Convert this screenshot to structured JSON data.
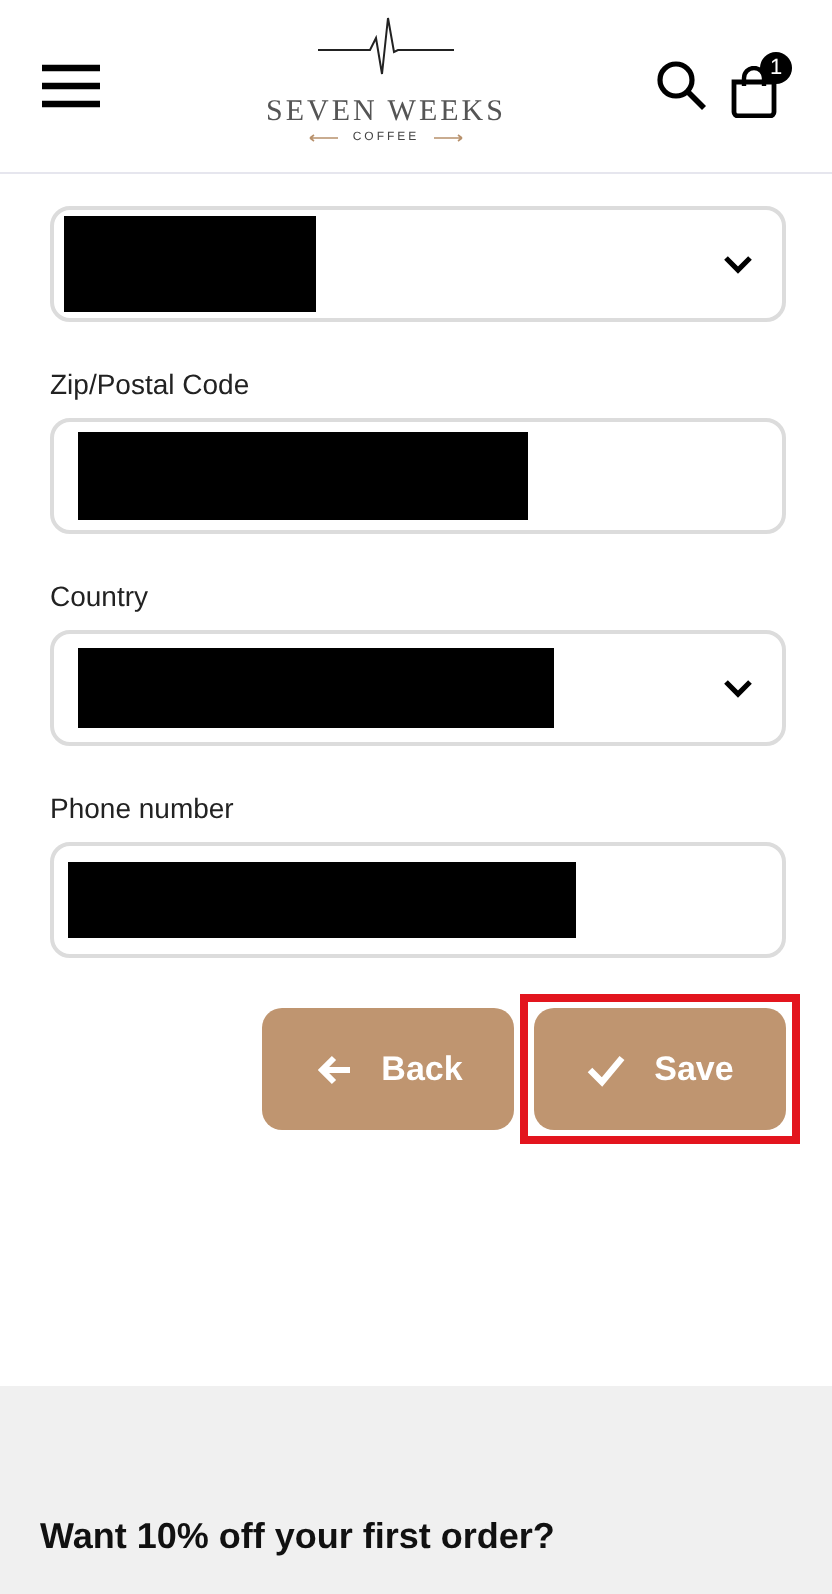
{
  "header": {
    "logo": {
      "name": "SEVEN WEEKS",
      "tagline": "COFFEE"
    },
    "cart_count": "1"
  },
  "fields": [
    {
      "kind": "select",
      "redacted": true
    },
    {
      "kind": "text",
      "label": "Zip/Postal Code",
      "redacted": true
    },
    {
      "kind": "select",
      "label": "Country",
      "redacted": true
    },
    {
      "kind": "text",
      "label": "Phone number",
      "redacted": true
    }
  ],
  "buttons": [
    {
      "kind": "back",
      "label": "Back",
      "highlighted": false
    },
    {
      "kind": "save",
      "label": "Save",
      "highlighted": true
    }
  ],
  "footer": {
    "heading": "Want 10% off your first order?"
  }
}
